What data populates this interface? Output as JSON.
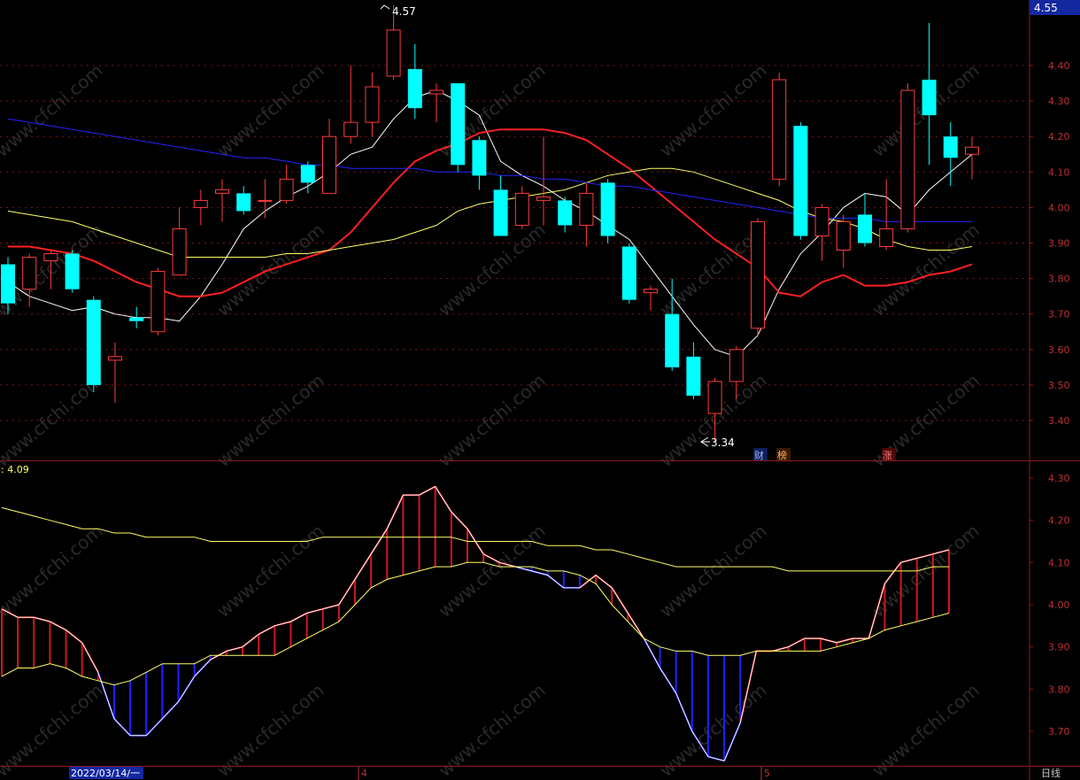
{
  "colors": {
    "background": "#000000",
    "frame": "#8b1a1a",
    "grid": "#8b1a1a",
    "axis_text": "#c03030",
    "up": "#ff3b3b",
    "down": "#00ffff",
    "ma5": "#ffffff",
    "ma10": "#ff2020",
    "ma30": "#ffff66",
    "ma60": "#2424ff",
    "bar_blue": "#2020ff",
    "bar_red": "#d01818",
    "price_box": "#1428a0",
    "watermark": "#2a2a2a"
  },
  "header": {
    "current_price": "4.55",
    "lower_value": ": 4.09",
    "date_label": "2022/03/14/一",
    "month_4": "4",
    "month_5": "5",
    "period_label": "日线",
    "marker_cai": "财",
    "marker_bang": "榜",
    "marker_zhang": "涨",
    "high_label": "4.57",
    "low_label": "3.34",
    "watermark": "www.cfchi.com"
  },
  "chart_data": [
    {
      "type": "candlestick",
      "title": "",
      "ylim": [
        3.3,
        4.57
      ],
      "yticks": [
        "4.40",
        "4.30",
        "4.20",
        "4.10",
        "4.00",
        "3.90",
        "3.80",
        "3.70",
        "3.60",
        "3.50",
        "3.40"
      ],
      "grid": true,
      "candles": [
        {
          "o": 3.84,
          "c": 3.73,
          "h": 3.86,
          "l": 3.7
        },
        {
          "o": 3.77,
          "c": 3.86,
          "h": 3.87,
          "l": 3.72
        },
        {
          "o": 3.85,
          "c": 3.87,
          "h": 3.88,
          "l": 3.77
        },
        {
          "o": 3.87,
          "c": 3.77,
          "h": 3.88,
          "l": 3.76
        },
        {
          "o": 3.74,
          "c": 3.5,
          "h": 3.75,
          "l": 3.48
        },
        {
          "o": 3.57,
          "c": 3.58,
          "h": 3.62,
          "l": 3.45
        },
        {
          "o": 3.69,
          "c": 3.68,
          "h": 3.72,
          "l": 3.66
        },
        {
          "o": 3.65,
          "c": 3.82,
          "h": 3.83,
          "l": 3.64
        },
        {
          "o": 3.81,
          "c": 3.94,
          "h": 4.0,
          "l": 3.81
        },
        {
          "o": 4.0,
          "c": 4.02,
          "h": 4.05,
          "l": 3.95
        },
        {
          "o": 4.04,
          "c": 4.05,
          "h": 4.08,
          "l": 3.96
        },
        {
          "o": 4.04,
          "c": 3.99,
          "h": 4.06,
          "l": 3.98
        },
        {
          "o": 4.02,
          "c": 4.02,
          "h": 4.08,
          "l": 3.97
        },
        {
          "o": 4.02,
          "c": 4.08,
          "h": 4.12,
          "l": 4.01
        },
        {
          "o": 4.12,
          "c": 4.07,
          "h": 4.13,
          "l": 4.04
        },
        {
          "o": 4.04,
          "c": 4.2,
          "h": 4.25,
          "l": 4.04
        },
        {
          "o": 4.2,
          "c": 4.24,
          "h": 4.4,
          "l": 4.18
        },
        {
          "o": 4.24,
          "c": 4.34,
          "h": 4.38,
          "l": 4.2
        },
        {
          "o": 4.37,
          "c": 4.5,
          "h": 4.57,
          "l": 4.36
        },
        {
          "o": 4.39,
          "c": 4.28,
          "h": 4.46,
          "l": 4.25
        },
        {
          "o": 4.32,
          "c": 4.33,
          "h": 4.35,
          "l": 4.24
        },
        {
          "o": 4.35,
          "c": 4.12,
          "h": 4.35,
          "l": 4.1
        },
        {
          "o": 4.19,
          "c": 4.09,
          "h": 4.2,
          "l": 4.05
        },
        {
          "o": 4.05,
          "c": 3.92,
          "h": 4.09,
          "l": 3.92
        },
        {
          "o": 3.95,
          "c": 4.04,
          "h": 4.06,
          "l": 3.94
        },
        {
          "o": 4.02,
          "c": 4.03,
          "h": 4.2,
          "l": 3.95
        },
        {
          "o": 4.02,
          "c": 3.95,
          "h": 4.03,
          "l": 3.93
        },
        {
          "o": 3.95,
          "c": 4.04,
          "h": 4.07,
          "l": 3.89
        },
        {
          "o": 4.07,
          "c": 3.92,
          "h": 4.08,
          "l": 3.9
        },
        {
          "o": 3.89,
          "c": 3.74,
          "h": 3.9,
          "l": 3.73
        },
        {
          "o": 3.76,
          "c": 3.77,
          "h": 3.78,
          "l": 3.71
        },
        {
          "o": 3.7,
          "c": 3.55,
          "h": 3.8,
          "l": 3.54
        },
        {
          "o": 3.58,
          "c": 3.47,
          "h": 3.62,
          "l": 3.46
        },
        {
          "o": 3.42,
          "c": 3.51,
          "h": 3.52,
          "l": 3.34
        },
        {
          "o": 3.51,
          "c": 3.6,
          "h": 3.61,
          "l": 3.46
        },
        {
          "o": 3.66,
          "c": 3.96,
          "h": 3.97,
          "l": 3.64
        },
        {
          "o": 4.08,
          "c": 4.36,
          "h": 4.38,
          "l": 4.06
        },
        {
          "o": 4.23,
          "c": 3.92,
          "h": 4.24,
          "l": 3.91
        },
        {
          "o": 3.92,
          "c": 4.0,
          "h": 4.01,
          "l": 3.85
        },
        {
          "o": 3.88,
          "c": 3.96,
          "h": 3.98,
          "l": 3.83
        },
        {
          "o": 3.98,
          "c": 3.9,
          "h": 4.04,
          "l": 3.89
        },
        {
          "o": 3.89,
          "c": 3.94,
          "h": 4.08,
          "l": 3.88
        },
        {
          "o": 3.94,
          "c": 4.33,
          "h": 4.35,
          "l": 3.93
        },
        {
          "o": 4.36,
          "c": 4.26,
          "h": 4.52,
          "l": 4.12
        },
        {
          "o": 4.2,
          "c": 4.14,
          "h": 4.24,
          "l": 4.06
        },
        {
          "o": 4.15,
          "c": 4.17,
          "h": 4.2,
          "l": 4.08
        }
      ],
      "series": [
        {
          "values": [
            3.79,
            3.75,
            3.73,
            3.71,
            3.72,
            3.7,
            3.69,
            3.69,
            3.68,
            3.75,
            3.84,
            3.94,
            3.99,
            4.03,
            4.06,
            4.1,
            4.15,
            4.17,
            4.25,
            4.31,
            4.33,
            4.3,
            4.26,
            4.13,
            4.09,
            4.06,
            4.02,
            3.99,
            3.95,
            3.91,
            3.83,
            3.75,
            3.67,
            3.6,
            3.58,
            3.64,
            3.77,
            3.87,
            3.93,
            4.0,
            4.04,
            4.03,
            3.98,
            4.05,
            4.1,
            4.15
          ]
        },
        {
          "values": [
            3.89,
            3.89,
            3.88,
            3.87,
            3.85,
            3.82,
            3.79,
            3.77,
            3.75,
            3.75,
            3.76,
            3.79,
            3.82,
            3.84,
            3.86,
            3.88,
            3.93,
            4.0,
            4.07,
            4.13,
            4.16,
            4.18,
            4.21,
            4.22,
            4.22,
            4.22,
            4.21,
            4.19,
            4.15,
            4.11,
            4.06,
            4.01,
            3.96,
            3.91,
            3.87,
            3.83,
            3.76,
            3.75,
            3.79,
            3.81,
            3.78,
            3.78,
            3.79,
            3.81,
            3.82,
            3.84
          ]
        },
        {
          "values": [
            3.99,
            3.98,
            3.97,
            3.96,
            3.94,
            3.92,
            3.9,
            3.88,
            3.86,
            3.86,
            3.86,
            3.86,
            3.86,
            3.87,
            3.87,
            3.88,
            3.89,
            3.9,
            3.91,
            3.93,
            3.95,
            3.99,
            4.01,
            4.02,
            4.03,
            4.04,
            4.05,
            4.07,
            4.09,
            4.1,
            4.11,
            4.11,
            4.1,
            4.08,
            4.06,
            4.04,
            4.02,
            3.99,
            3.97,
            3.96,
            3.94,
            3.91,
            3.89,
            3.88,
            3.88,
            3.89
          ]
        },
        {
          "values": [
            4.25,
            4.24,
            4.23,
            4.22,
            4.21,
            4.2,
            4.19,
            4.18,
            4.17,
            4.16,
            4.15,
            4.14,
            4.14,
            4.13,
            4.12,
            4.12,
            4.11,
            4.11,
            4.11,
            4.11,
            4.1,
            4.1,
            4.1,
            4.09,
            4.09,
            4.08,
            4.08,
            4.07,
            4.06,
            4.06,
            4.05,
            4.04,
            4.03,
            4.02,
            4.01,
            4.0,
            3.99,
            3.98,
            3.97,
            3.97,
            3.97,
            3.96,
            3.96,
            3.96,
            3.96,
            3.96
          ]
        }
      ]
    },
    {
      "type": "bar",
      "title": "",
      "ylim": [
        3.62,
        4.32
      ],
      "yticks": [
        "4.30",
        "4.20",
        "4.10",
        "4.00",
        "3.90",
        "3.80",
        "3.70"
      ],
      "grid": false,
      "series": [
        {
          "values": [
            3.99,
            3.97,
            3.97,
            3.96,
            3.94,
            3.91,
            3.84,
            3.73,
            3.69,
            3.69,
            3.73,
            3.77,
            3.83,
            3.87,
            3.89,
            3.9,
            3.93,
            3.95,
            3.96,
            3.98,
            3.99,
            4.0,
            4.06,
            4.12,
            4.18,
            4.26,
            4.26,
            4.28,
            4.22,
            4.18,
            4.12,
            4.1,
            4.09,
            4.08,
            4.07,
            4.04,
            4.04,
            4.07,
            4.04,
            3.98,
            3.92,
            3.85,
            3.79,
            3.7,
            3.64,
            3.63,
            3.72,
            3.89,
            3.89,
            3.9,
            3.92,
            3.92,
            3.91,
            3.92,
            3.92,
            4.05,
            4.1,
            4.11,
            4.12,
            4.13
          ]
        },
        {
          "values": [
            3.83,
            3.85,
            3.85,
            3.86,
            3.85,
            3.83,
            3.82,
            3.81,
            3.82,
            3.84,
            3.86,
            3.86,
            3.86,
            3.88,
            3.88,
            3.88,
            3.88,
            3.88,
            3.9,
            3.92,
            3.94,
            3.96,
            4.0,
            4.04,
            4.06,
            4.07,
            4.08,
            4.09,
            4.09,
            4.1,
            4.1,
            4.09,
            4.09,
            4.09,
            4.08,
            4.08,
            4.07,
            4.05,
            4.0,
            3.96,
            3.92,
            3.9,
            3.89,
            3.89,
            3.88,
            3.88,
            3.88,
            3.89,
            3.89,
            3.89,
            3.89,
            3.89,
            3.9,
            3.91,
            3.92,
            3.94,
            3.95,
            3.96,
            3.97,
            3.98
          ]
        },
        {
          "values": [
            4.23,
            4.22,
            4.21,
            4.2,
            4.19,
            4.18,
            4.18,
            4.17,
            4.17,
            4.16,
            4.16,
            4.16,
            4.16,
            4.15,
            4.15,
            4.15,
            4.15,
            4.15,
            4.15,
            4.15,
            4.16,
            4.16,
            4.16,
            4.16,
            4.16,
            4.16,
            4.16,
            4.16,
            4.16,
            4.15,
            4.15,
            4.15,
            4.15,
            4.15,
            4.14,
            4.14,
            4.14,
            4.13,
            4.13,
            4.12,
            4.11,
            4.1,
            4.09,
            4.09,
            4.09,
            4.09,
            4.09,
            4.09,
            4.09,
            4.08,
            4.08,
            4.08,
            4.08,
            4.08,
            4.08,
            4.08,
            4.08,
            4.08,
            4.09,
            4.09
          ]
        }
      ]
    }
  ]
}
